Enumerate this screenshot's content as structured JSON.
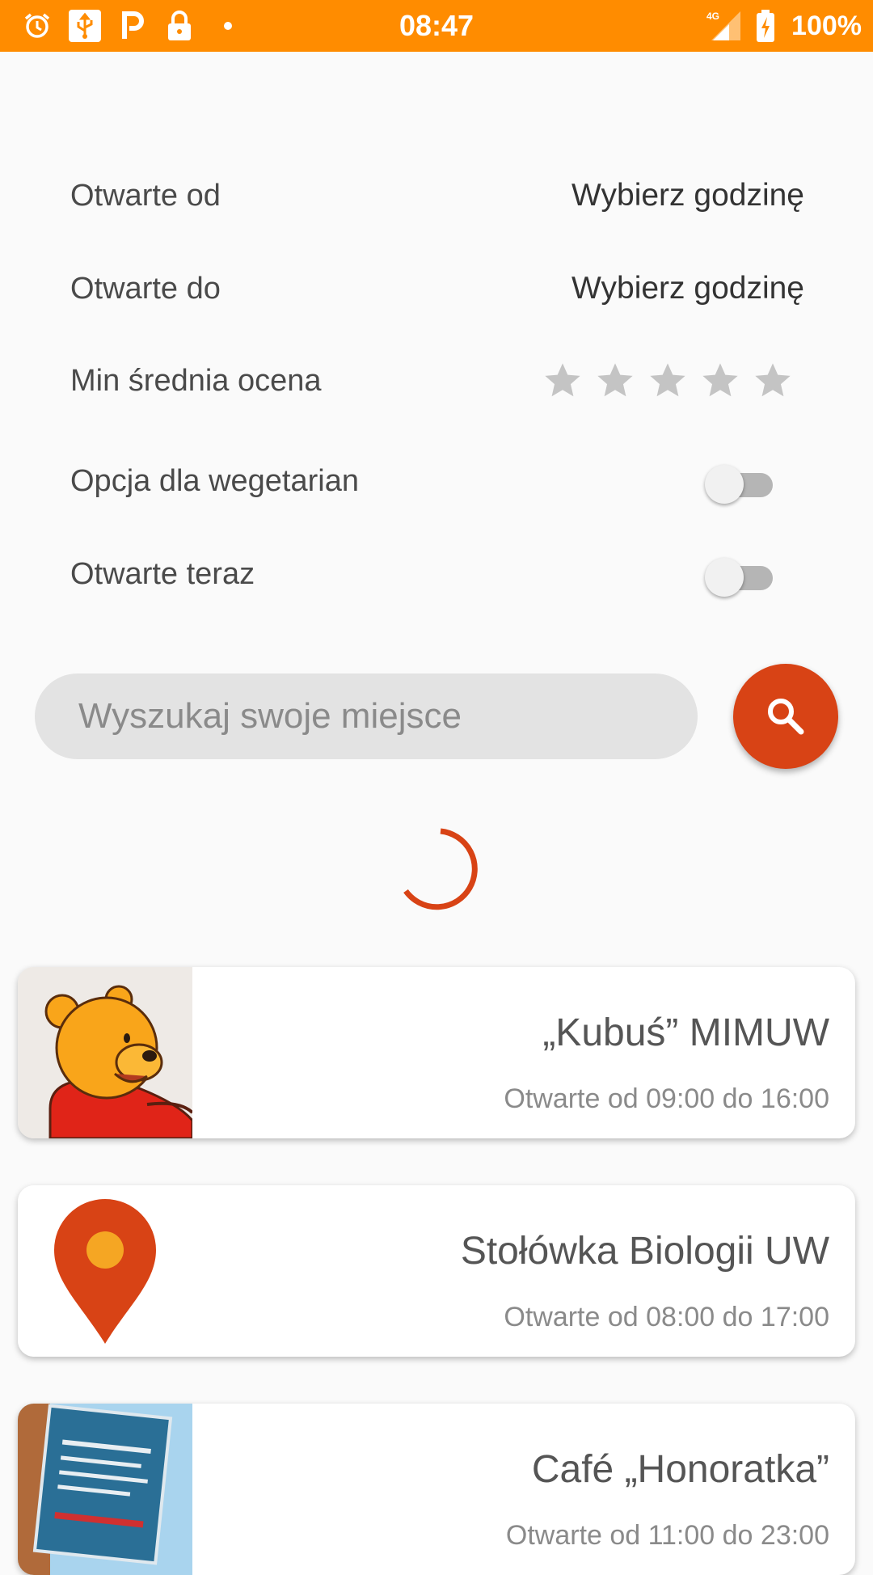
{
  "status_bar": {
    "time": "08:47",
    "battery": "100%",
    "network": "4G",
    "icons": [
      "alarm-icon",
      "usb-icon",
      "parking-icon",
      "lock-icon",
      "dot-icon",
      "signal-icon",
      "battery-charging-icon"
    ]
  },
  "filters": {
    "open_from": {
      "label": "Otwarte od",
      "value": "Wybierz godzinę"
    },
    "open_to": {
      "label": "Otwarte do",
      "value": "Wybierz godzinę"
    },
    "min_rating": {
      "label": "Min średnia ocena",
      "stars_total": 5,
      "stars_selected": 0
    },
    "vegetarian": {
      "label": "Opcja dla wegetarian",
      "on": false
    },
    "open_now": {
      "label": "Otwarte teraz",
      "on": false
    }
  },
  "search": {
    "placeholder": "Wyszukaj swoje miejsce",
    "value": ""
  },
  "places": [
    {
      "name": "„Kubuś” MIMUW",
      "hours": "Otwarte od 09:00 do 16:00",
      "thumbnail": "winnie-the-pooh-image"
    },
    {
      "name": "Stołówka Biologii UW",
      "hours": "Otwarte od 08:00 do 17:00",
      "thumbnail": "location-pin-icon"
    },
    {
      "name": "Café „Honoratka”",
      "hours": "Otwarte od 11:00 do 23:00",
      "thumbnail": "cafe-sign-photo"
    }
  ],
  "colors": {
    "status_bar": "#ff8c00",
    "accent": "#d84315",
    "pin_dot": "#f5a623"
  }
}
